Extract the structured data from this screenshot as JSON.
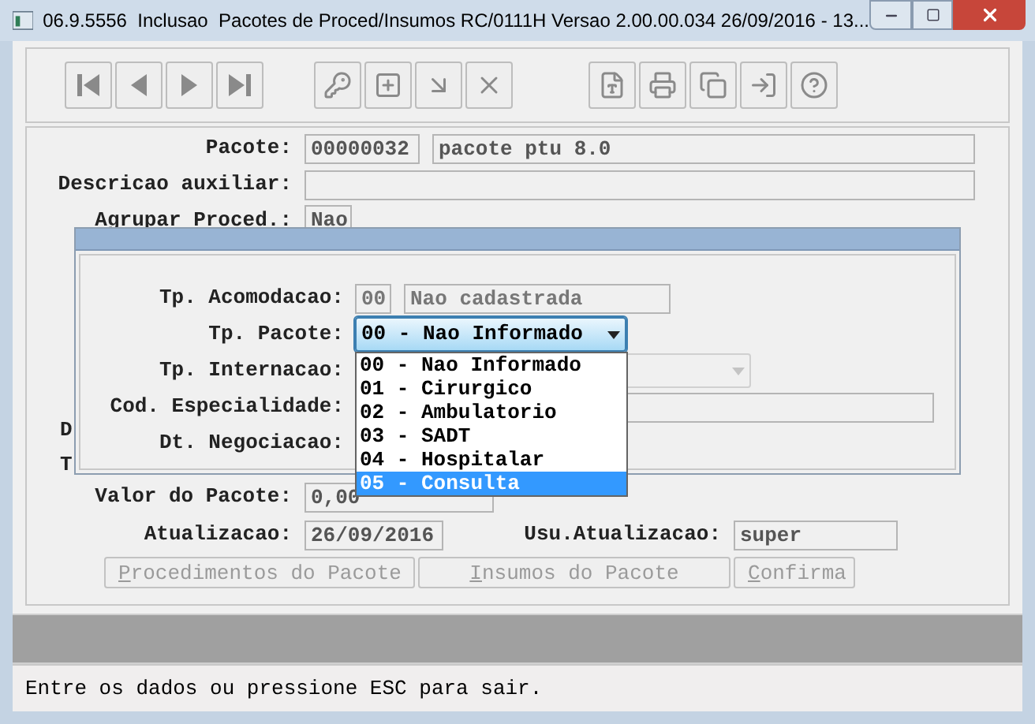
{
  "window": {
    "title": "06.9.5556  Inclusao  Pacotes de Proced/Insumos RC/0111H Versao 2.00.00.034 26/09/2016 - 13..."
  },
  "form": {
    "pacote": {
      "label": "Pacote:",
      "code": "00000032",
      "description": "pacote ptu 8.0"
    },
    "descricao_auxiliar": {
      "label": "Descricao auxiliar:"
    },
    "agrupar": {
      "label": "Agrupar Proced.:",
      "value": "Nao"
    },
    "covered_labels": [
      "D",
      "T"
    ],
    "valor": {
      "label": "Valor do Pacote:",
      "value": "0,00"
    },
    "atualizacao": {
      "label": "Atualizacao:",
      "value": "26/09/2016"
    },
    "usu_atualizacao": {
      "label": "Usu.Atualizacao:",
      "value": "super"
    }
  },
  "buttons": [
    {
      "label": "Procedimentos do Pacote",
      "disabled": true
    },
    {
      "label": "Insumos do Pacote",
      "disabled": true
    },
    {
      "label": "Confirma",
      "disabled": true
    }
  ],
  "dialog": {
    "fields": [
      {
        "kind": "pair",
        "label": "Tp. Acomodacao:",
        "code": "00",
        "value": "Nao cadastrada"
      },
      {
        "kind": "combo",
        "label": "Tp. Pacote:",
        "value": "00 - Nao Informado",
        "expanded": true,
        "disabled": false
      },
      {
        "kind": "combo",
        "label": "Tp. Internacao:",
        "expanded": false,
        "disabled": true
      },
      {
        "kind": "text",
        "label": "Cod. Especialidade:"
      },
      {
        "kind": "covered",
        "label": "Dt. Negociacao:"
      }
    ],
    "options": [
      {
        "label": "00 - Nao Informado",
        "selected": false
      },
      {
        "label": "01 - Cirurgico",
        "selected": false
      },
      {
        "label": "02 - Ambulatorio",
        "selected": false
      },
      {
        "label": "03 - SADT",
        "selected": false
      },
      {
        "label": "04 - Hospitalar",
        "selected": false
      },
      {
        "label": "05 - Consulta",
        "selected": true
      }
    ]
  },
  "status_bar": "Entre os dados ou pressione ESC para sair."
}
